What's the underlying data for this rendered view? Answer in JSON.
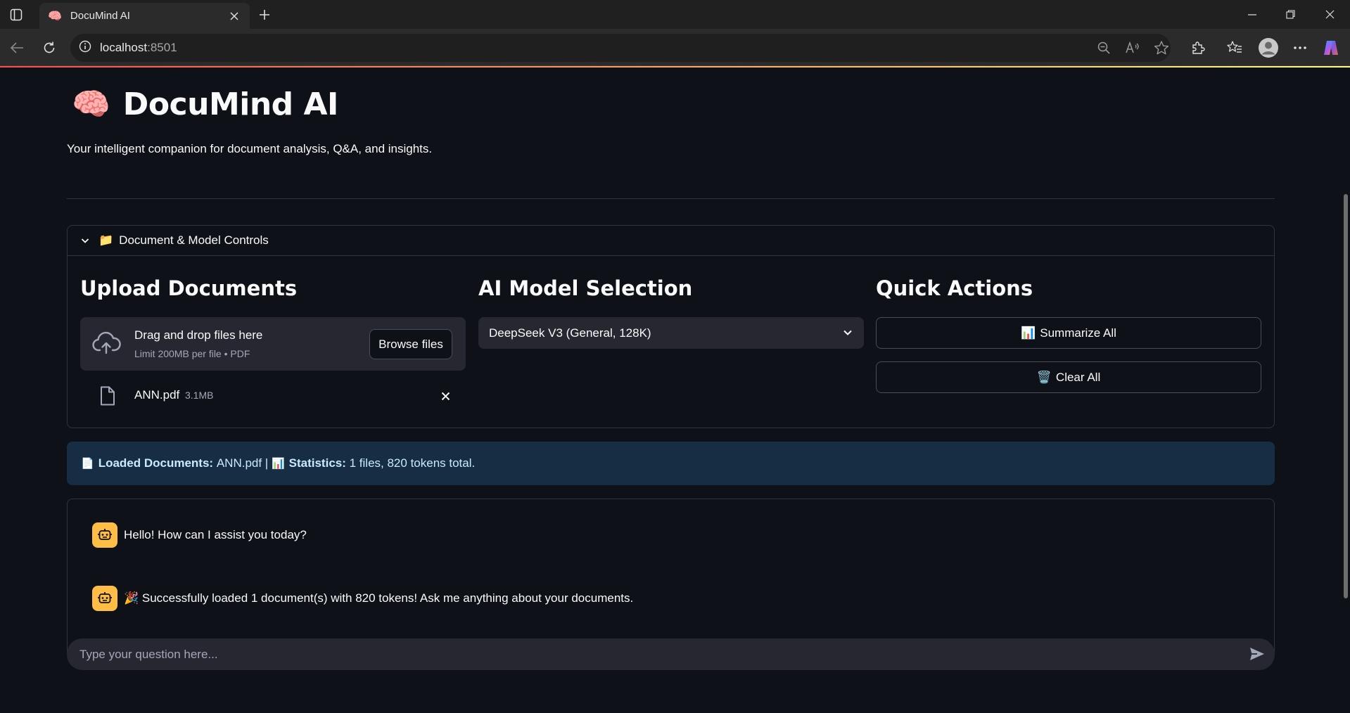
{
  "browser": {
    "tab_title": "DocuMind AI",
    "url_host": "localhost",
    "url_port": ":8501"
  },
  "app": {
    "title": "DocuMind AI",
    "title_emoji": "🧠",
    "subtitle": "Your intelligent companion for document analysis, Q&A, and insights."
  },
  "expander": {
    "emoji": "📁",
    "label": "Document & Model Controls"
  },
  "upload": {
    "heading": "Upload Documents",
    "drag_text": "Drag and drop files here",
    "limit_text": "Limit 200MB per file • PDF",
    "browse_label": "Browse files",
    "files": [
      {
        "name": "ANN.pdf",
        "size": "3.1MB"
      }
    ]
  },
  "model": {
    "heading": "AI Model Selection",
    "selected": "DeepSeek V3 (General, 128K)"
  },
  "quick_actions": {
    "heading": "Quick Actions",
    "summarize_emoji": "📊",
    "summarize_label": "Summarize All",
    "clear_emoji": "🗑️",
    "clear_label": "Clear All"
  },
  "info": {
    "doc_emoji": "📄",
    "loaded_label": "Loaded Documents:",
    "loaded_value": "ANN.pdf |",
    "stats_emoji": "📊",
    "stats_label": "Statistics:",
    "stats_value": "1 files, 820 tokens total."
  },
  "chat": {
    "messages": [
      {
        "role": "assistant",
        "text": "Hello! How can I assist you today?"
      },
      {
        "role": "assistant",
        "text": "🎉 Successfully loaded 1 document(s) with 820 tokens! Ask me anything about your documents."
      }
    ],
    "placeholder": "Type your question here..."
  },
  "colors": {
    "background": "#0e1117",
    "secondary_bg": "#262730",
    "info_bg": "#172d43",
    "avatar": "#ffbd45"
  }
}
